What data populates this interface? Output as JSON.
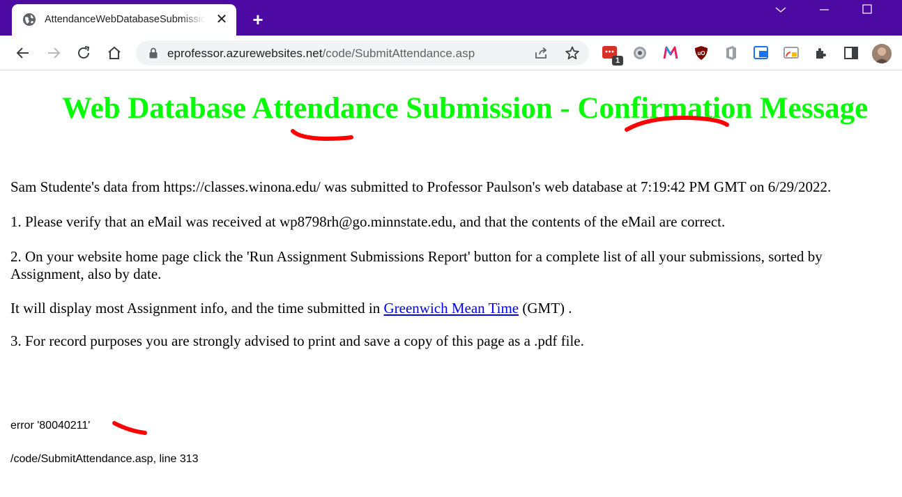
{
  "browser": {
    "tab": {
      "title": "AttendanceWebDatabaseSubmission",
      "close_glyph": "✕",
      "favicon_icon": "globe-icon"
    },
    "new_tab_glyph": "+",
    "address_bar": {
      "domain": "eprofessor.azurewebsites.net",
      "path": "/code/SubmitAttendance.asp"
    },
    "extension_badge": "1",
    "theme_color": "#4d0aa3"
  },
  "page": {
    "heading": "Web Database Attendance Submission - Confirmation Message",
    "heading_color": "#00ff00",
    "summary": "Sam Studente's data from https://classes.winona.edu/ was submitted to Professor Paulson's web database at 7:19:42 PM GMT on 6/29/2022.",
    "step1": "1. Please verify that an eMail was received at wp8798rh@go.minnstate.edu, and that the contents of the eMail are correct.",
    "step2": "2. On your website home page click the 'Run Assignment Submissions Report' button for a complete list of all your submissions, sorted by Assignment, also by date.",
    "display_prefix": "It will display most Assignment info, and the time submitted in ",
    "display_link": "Greenwich Mean Time",
    "display_suffix": " (GMT) .",
    "step3": "3. For record purposes you are strongly advised to print and save a copy of this page as a .pdf file.",
    "error_code": "error '80040211'",
    "error_location": "/code/SubmitAttendance.asp, line 313",
    "annotation_color": "#ff0000"
  }
}
